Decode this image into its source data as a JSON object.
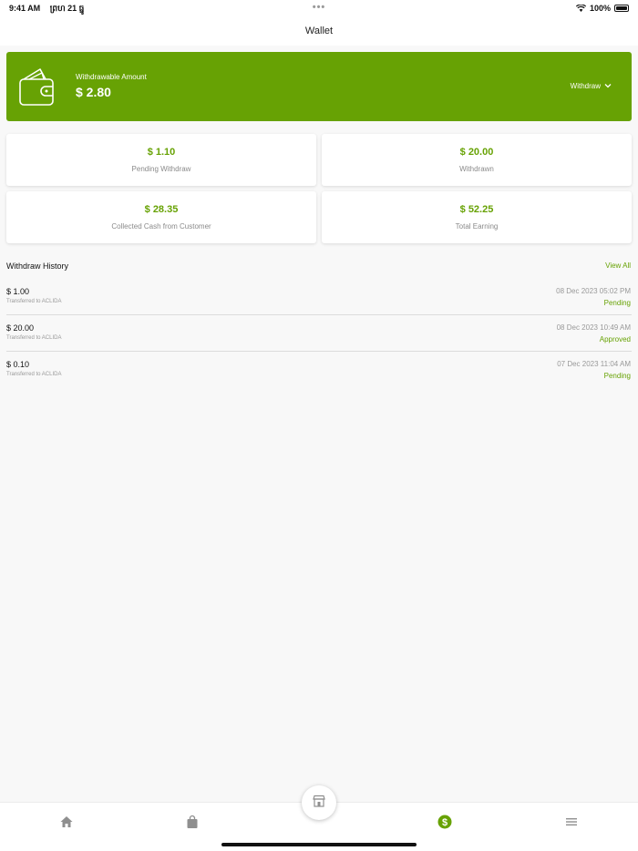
{
  "status_bar": {
    "time": "9:41 AM",
    "date": "ព្រហ 21 ធ្នូ",
    "battery": "100%"
  },
  "header": {
    "title": "Wallet"
  },
  "banner": {
    "label": "Withdrawable Amount",
    "amount": "$ 2.80",
    "withdraw_label": "Withdraw"
  },
  "stats": [
    {
      "value": "$ 1.10",
      "caption": "Pending Withdraw"
    },
    {
      "value": "$ 20.00",
      "caption": "Withdrawn"
    },
    {
      "value": "$ 28.35",
      "caption": "Collected Cash from Customer"
    },
    {
      "value": "$ 52.25",
      "caption": "Total Earning"
    }
  ],
  "history": {
    "title": "Withdraw History",
    "view_all": "View All",
    "rows": [
      {
        "amount": "$ 1.00",
        "sub": "Transferred to ACLIDA",
        "date": "08 Dec 2023  05:02 PM",
        "status": "Pending"
      },
      {
        "amount": "$ 20.00",
        "sub": "Transferred to ACLIDA",
        "date": "08 Dec 2023  10:49 AM",
        "status": "Approved"
      },
      {
        "amount": "$ 0.10",
        "sub": "Transferred to ACLIDA",
        "date": "07 Dec 2023  11:04 AM",
        "status": "Pending"
      }
    ]
  },
  "colors": {
    "accent": "#67a204",
    "nav_inactive": "#8f8f8f"
  },
  "icons": {
    "banner": "wallet-icon",
    "withdraw": "chevron-down-icon",
    "nav": [
      "home-icon",
      "shopping-bag-icon",
      "store-icon",
      "dollar-icon",
      "menu-icon"
    ]
  }
}
